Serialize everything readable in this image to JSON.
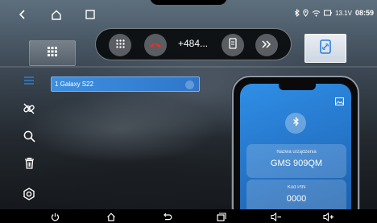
{
  "status_bar": {
    "voltage": "13.1V",
    "time": "08:59",
    "icons": [
      "bluetooth-icon",
      "location-icon",
      "wifi-icon",
      "battery-icon"
    ]
  },
  "top_nav": {
    "icons": [
      "back-icon",
      "home-icon",
      "recents-icon"
    ]
  },
  "call_bar": {
    "number": "+484...",
    "buttons": [
      "dialpad-icon",
      "end-call-icon",
      "phone-switch-icon",
      "forward-icon"
    ],
    "end_call_color": "#e0342c"
  },
  "tabs": {
    "left_icon": "grid-icon",
    "right_icon": "phone-link-icon"
  },
  "sidebar": {
    "icons": [
      "list-icon",
      "unlink-icon",
      "search-icon",
      "trash-icon",
      "settings-icon"
    ]
  },
  "device_list": {
    "items": [
      {
        "label": "1 Galaxy S22"
      }
    ]
  },
  "phone_panel": {
    "device_name_label": "Nazwa urządzenia",
    "device_name": "GMS 909QM",
    "pin_label": "Kod PIN",
    "pin": "0000"
  },
  "bottom_bar": {
    "icons": [
      "power-icon",
      "home-outline-icon",
      "back-arrow-icon",
      "recent-apps-icon",
      "volume-down-icon",
      "volume-up-icon"
    ]
  },
  "colors": {
    "accent_blue": "#2f7fd6",
    "highlight_blue": "#3e8fe0"
  }
}
